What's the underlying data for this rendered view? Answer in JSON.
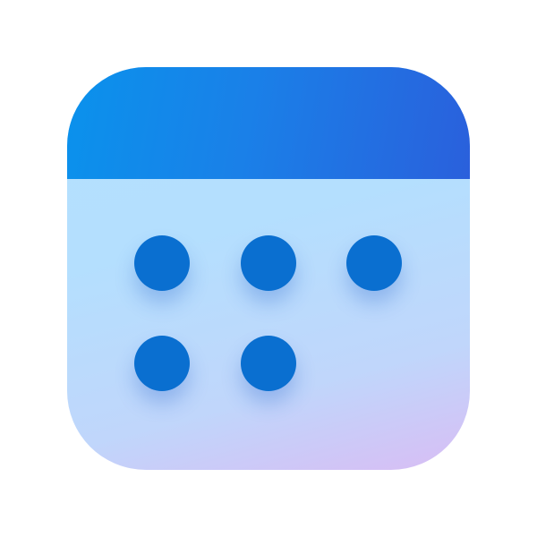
{
  "icon": {
    "name": "calendar-icon",
    "colors": {
      "header_start": "#0a92ec",
      "header_end": "#2a60dc",
      "body_top": "#b4e0fe",
      "body_bottom": "#d8bdf4",
      "dot": "#0a6fd0"
    },
    "date_dots": 5
  }
}
